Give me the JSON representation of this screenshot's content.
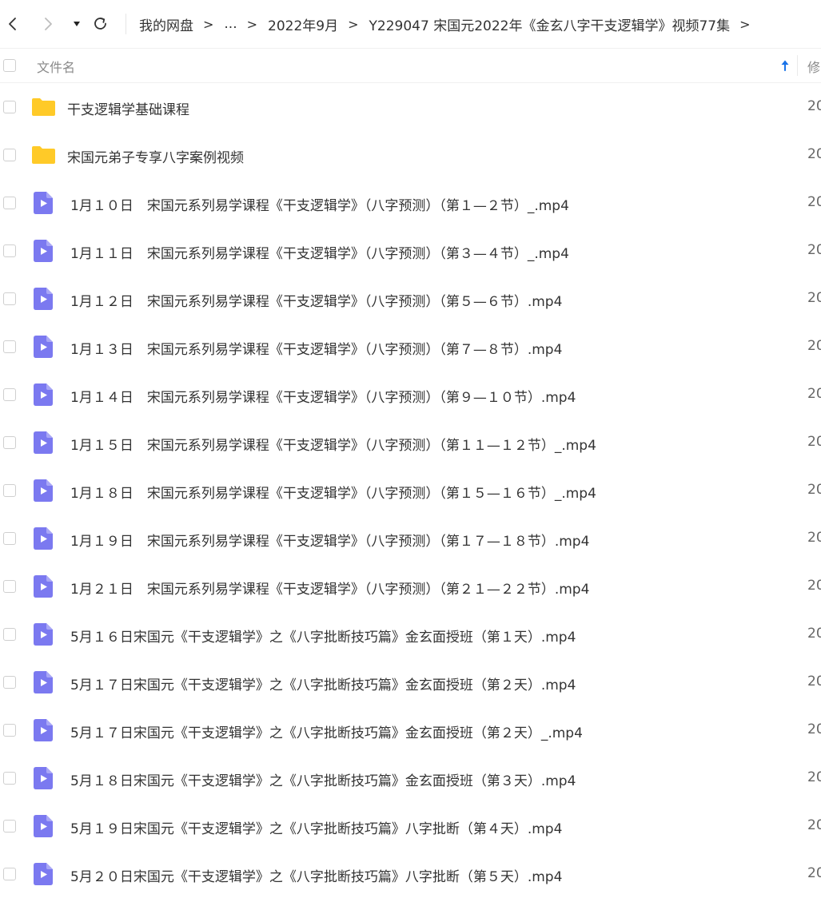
{
  "nav": {
    "back_icon": "chevron-left-icon",
    "forward_icon": "chevron-right-icon",
    "dropdown_icon": "caret-down-icon",
    "refresh_icon": "refresh-icon"
  },
  "breadcrumb": {
    "root": "我的网盘",
    "ellipsis": "...",
    "folder": "2022年9月",
    "current": "Y229047 宋国元2022年《金玄八字干支逻辑学》视频77集",
    "separator": ">"
  },
  "header": {
    "name_column": "文件名",
    "modified_column": "修",
    "sort_icon": "arrow-up-icon"
  },
  "colors": {
    "folder": "#ffca28",
    "video": "#7b79f0",
    "accent": "#1a73e8"
  },
  "files": [
    {
      "type": "folder",
      "name": "干支逻辑学基础课程",
      "modified": "20"
    },
    {
      "type": "folder",
      "name": "宋国元弟子专享八字案例视频",
      "modified": "20"
    },
    {
      "type": "video",
      "name": "1月１０日　宋国元系列易学课程《干支逻辑学》（八字预测）（第１—２节）_.mp4",
      "modified": "20"
    },
    {
      "type": "video",
      "name": "1月１１日　宋国元系列易学课程《干支逻辑学》（八字预测）（第３—４节）_.mp4",
      "modified": "20"
    },
    {
      "type": "video",
      "name": "1月１２日　宋国元系列易学课程《干支逻辑学》（八字预测）（第５—６节）.mp4",
      "modified": "20"
    },
    {
      "type": "video",
      "name": "1月１３日　宋国元系列易学课程《干支逻辑学》（八字预测）（第７—８节）.mp4",
      "modified": "20"
    },
    {
      "type": "video",
      "name": "1月１４日　宋国元系列易学课程《干支逻辑学》（八字预测）（第９—１０节）.mp4",
      "modified": "20"
    },
    {
      "type": "video",
      "name": "1月１５日　宋国元系列易学课程《干支逻辑学》（八字预测）（第１１—１２节）_.mp4",
      "modified": "20"
    },
    {
      "type": "video",
      "name": "1月１８日　宋国元系列易学课程《干支逻辑学》（八字预测）（第１５—１６节）_.mp4",
      "modified": "20"
    },
    {
      "type": "video",
      "name": "1月１９日　宋国元系列易学课程《干支逻辑学》（八字预测）（第１７—１８节）.mp4",
      "modified": "20"
    },
    {
      "type": "video",
      "name": "1月２１日　宋国元系列易学课程《干支逻辑学》（八字预测）（第２１—２２节）.mp4",
      "modified": "20"
    },
    {
      "type": "video",
      "name": "5月１６日宋国元《干支逻辑学》之《八字批断技巧篇》金玄面授班（第１天）.mp4",
      "modified": "20"
    },
    {
      "type": "video",
      "name": "5月１７日宋国元《干支逻辑学》之《八字批断技巧篇》金玄面授班（第２天）.mp4",
      "modified": "20"
    },
    {
      "type": "video",
      "name": "5月１７日宋国元《干支逻辑学》之《八字批断技巧篇》金玄面授班（第２天）_.mp4",
      "modified": "20"
    },
    {
      "type": "video",
      "name": "5月１８日宋国元《干支逻辑学》之《八字批断技巧篇》金玄面授班（第３天）.mp4",
      "modified": "20"
    },
    {
      "type": "video",
      "name": "5月１９日宋国元《干支逻辑学》之《八字批断技巧篇》八字批断（第４天）.mp4",
      "modified": "20"
    },
    {
      "type": "video",
      "name": "5月２０日宋国元《干支逻辑学》之《八字批断技巧篇》八字批断（第５天）.mp4",
      "modified": "20"
    }
  ]
}
